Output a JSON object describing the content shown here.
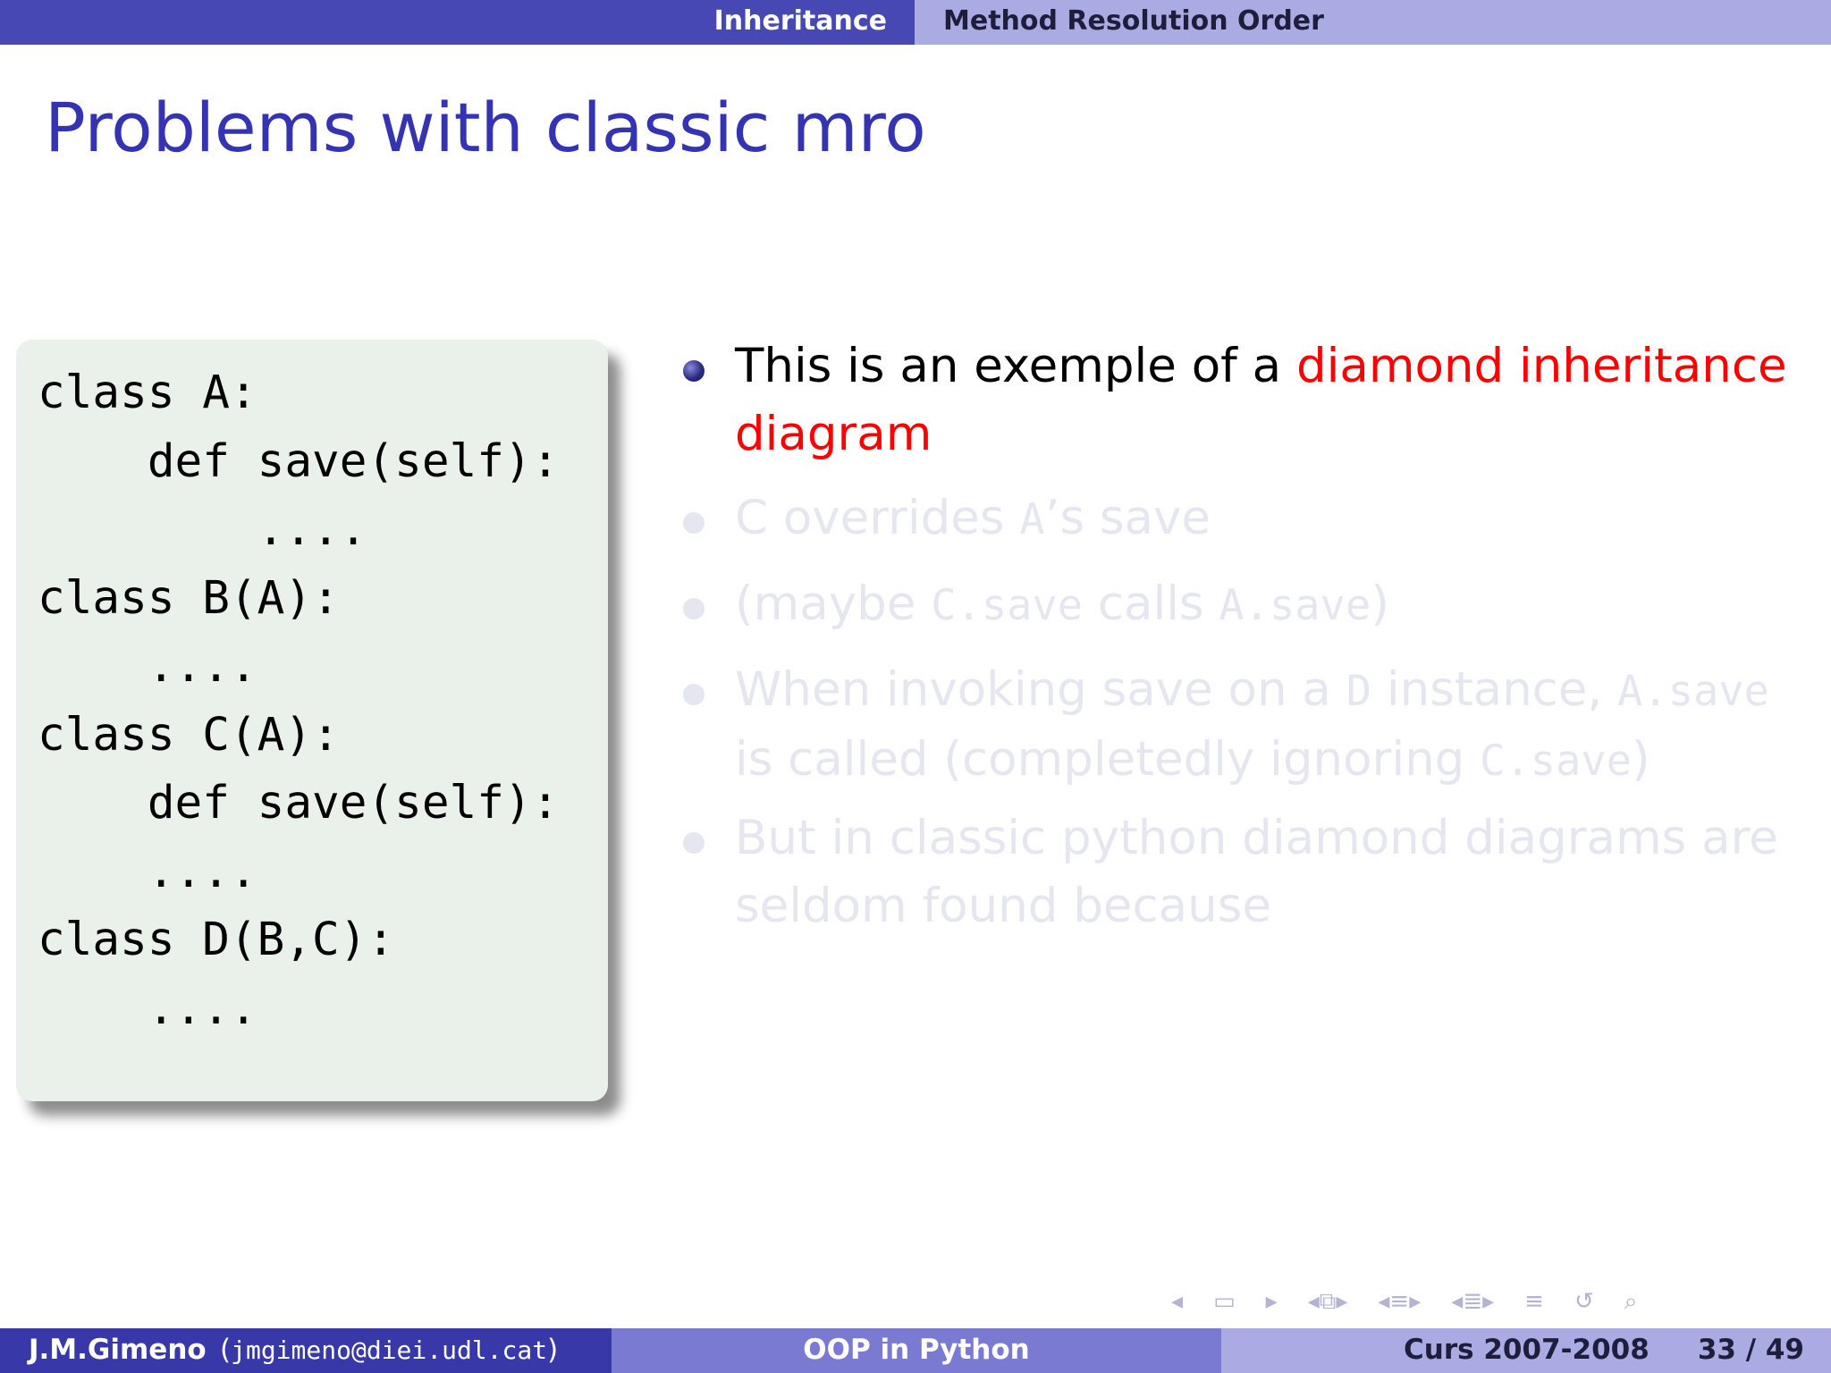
{
  "header": {
    "section": "Inheritance",
    "subsection": "Method Resolution Order"
  },
  "slide": {
    "title": "Problems with classic mro",
    "code": "class A:\n    def save(self):\n        ....\nclass B(A):\n    ....\nclass C(A):\n    def save(self):\n    ....\nclass D(B,C):\n    ....",
    "bullets": [
      {
        "parts": [
          "This is an exemple of a ",
          "diamond inheritance diagram"
        ]
      },
      {
        "parts": [
          "C overrides ",
          "A",
          "’s save"
        ]
      },
      {
        "parts": [
          "(maybe ",
          "C.save",
          " calls ",
          "A.save",
          ")"
        ]
      },
      {
        "parts": [
          "When invoking save on a ",
          "D",
          " instance, ",
          "A.save",
          " is called (completedly ignoring ",
          "C.save",
          ")"
        ]
      },
      {
        "parts": [
          "But in classic python diamond diagrams are seldom found because"
        ]
      }
    ]
  },
  "colors": {
    "header_left": "#4848b4",
    "header_right": "#ababe3",
    "title": "#3333b3",
    "highlight": "#ff0000",
    "code_bg": "#eaf1ea",
    "dimmed_text": "#e6e6f0"
  },
  "nav_icons": [
    "nav-left-arrow-icon",
    "slide-icon",
    "nav-right-arrow-icon",
    "frame-icon",
    "section-icon",
    "subsection-icon",
    "toc-icon",
    "search-icon",
    "undo-icon"
  ],
  "footer": {
    "author": "J.M.Gimeno",
    "email": "jmgimeno@diei.udl.cat",
    "title": "OOP in Python",
    "course": "Curs 2007-2008",
    "page": "33 / 49"
  }
}
